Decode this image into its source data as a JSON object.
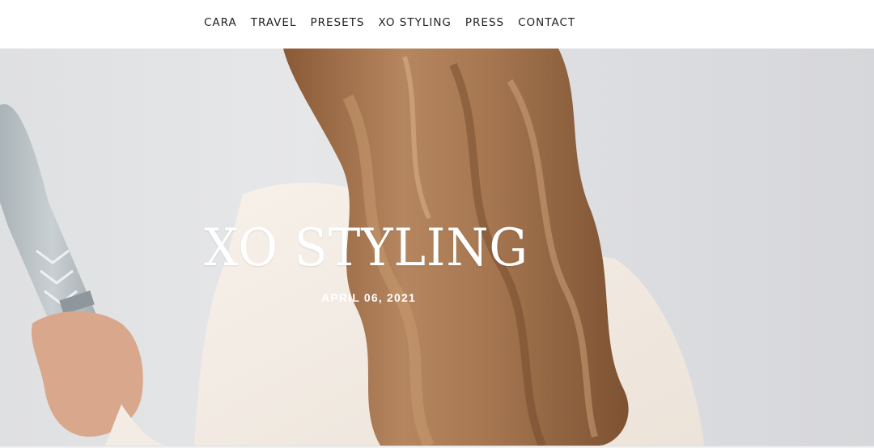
{
  "nav": {
    "items": [
      {
        "label": "CARA"
      },
      {
        "label": "TRAVEL"
      },
      {
        "label": "PRESETS"
      },
      {
        "label": "XO STYLING"
      },
      {
        "label": "PRESS"
      },
      {
        "label": "CONTACT"
      }
    ]
  },
  "hero": {
    "title": "XO STYLING",
    "date": "APRIL 06, 2021",
    "image": "woman-with-wavy-hair-and-flat-iron-photo"
  },
  "colors": {
    "nav_text": "#222222",
    "hero_text": "#ffffff",
    "hair": "#a87a52"
  }
}
